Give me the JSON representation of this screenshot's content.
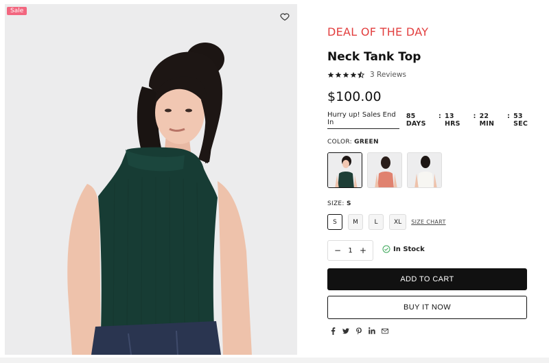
{
  "product_image": {
    "sale_badge": "Sale",
    "wishlist_icon": "heart-icon"
  },
  "deal": {
    "title": "DEAL OF THE DAY"
  },
  "product": {
    "title": "Neck Tank Top",
    "rating": 4.5,
    "reviews_label": "3 Reviews",
    "price": "$100.00"
  },
  "countdown": {
    "label": "Hurry up! Sales End In",
    "days": "85 DAYS",
    "hours": "13  HRS",
    "minutes": "22 MIN",
    "seconds": "53 SEC",
    "separator": ":"
  },
  "color": {
    "label": "COLOR:",
    "selected": "GREEN",
    "swatch_colors": [
      "#1e3e36",
      "#e0826f",
      "#efeeea"
    ]
  },
  "size": {
    "label": "SIZE:",
    "selected": "S",
    "options": [
      "S",
      "M",
      "L",
      "XL"
    ],
    "chart_link": "SIZE CHART"
  },
  "quantity": {
    "minus": "−",
    "value": "1",
    "plus": "+"
  },
  "stock": {
    "label": "In Stock",
    "icon": "check-circle-icon",
    "color": "#3aa657"
  },
  "buttons": {
    "add_to_cart": "ADD TO CART",
    "buy_now": "BUY IT NOW"
  },
  "share": {
    "icons": [
      "facebook-icon",
      "twitter-icon",
      "pinterest-icon",
      "linkedin-icon",
      "email-icon"
    ]
  },
  "colors": {
    "deal_red": "#e23e3e",
    "sale_pink": "#f2667f",
    "primary": "#111111"
  }
}
